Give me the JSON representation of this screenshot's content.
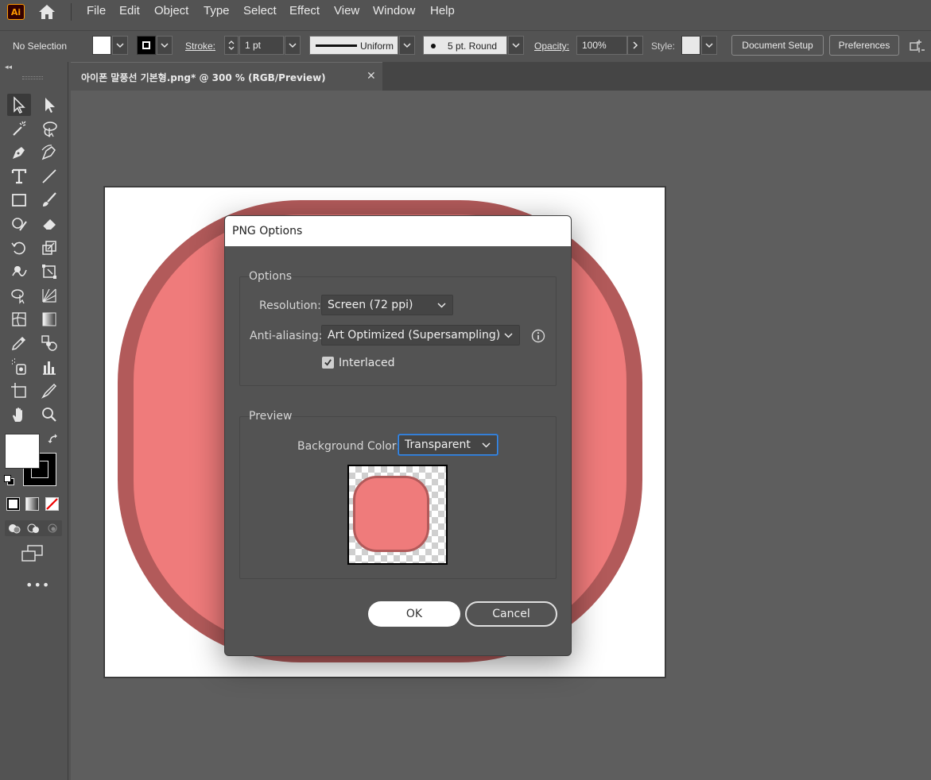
{
  "app": {
    "logo": "Ai"
  },
  "menu": [
    "File",
    "Edit",
    "Object",
    "Type",
    "Select",
    "Effect",
    "View",
    "Window",
    "Help"
  ],
  "control_bar": {
    "selection": "No Selection",
    "stroke_label": "Stroke:",
    "stroke_weight": "1 pt",
    "profile": "Uniform",
    "brush": "5 pt. Round",
    "opacity_label": "Opacity:",
    "opacity_value": "100%",
    "style_label": "Style:",
    "document_setup": "Document Setup",
    "preferences": "Preferences"
  },
  "tab": {
    "title": "아이폰 말풍선 기본형.png* @ 300 %   (RGB/Preview)",
    "close": "✕"
  },
  "dialog": {
    "title": "PNG Options",
    "options_group": "Options",
    "resolution_label": "Resolution:",
    "resolution_value": "Screen (72 ppi)",
    "antialias_label": "Anti-aliasing:",
    "antialias_value": "Art Optimized (Supersampling)",
    "interlaced_label": "Interlaced",
    "interlaced_checked": true,
    "preview_group": "Preview",
    "bgcolor_label": "Background Color:",
    "bgcolor_value": "Transparent",
    "ok": "OK",
    "cancel": "Cancel"
  },
  "colors": {
    "shape_fill": "#ef7b7b",
    "shape_stroke": "#b25a5a",
    "ui_bg": "#535353",
    "focus": "#3d8ee8"
  },
  "toolbar_icons": [
    "selection-tool-icon",
    "direct-selection-tool-icon",
    "magic-wand-tool-icon",
    "lasso-tool-icon",
    "pen-tool-icon",
    "curvature-tool-icon",
    "type-tool-icon",
    "line-segment-tool-icon",
    "rectangle-tool-icon",
    "paintbrush-tool-icon",
    "shaper-tool-icon",
    "eraser-tool-icon",
    "rotate-tool-icon",
    "scale-tool-icon",
    "warp-tool-icon",
    "free-transform-tool-icon",
    "shape-builder-tool-icon",
    "perspective-grid-tool-icon",
    "mesh-tool-icon",
    "gradient-tool-icon",
    "eyedropper-tool-icon",
    "blend-tool-icon",
    "symbol-sprayer-tool-icon",
    "column-graph-tool-icon",
    "artboard-tool-icon",
    "slice-tool-icon",
    "hand-tool-icon",
    "zoom-tool-icon"
  ]
}
